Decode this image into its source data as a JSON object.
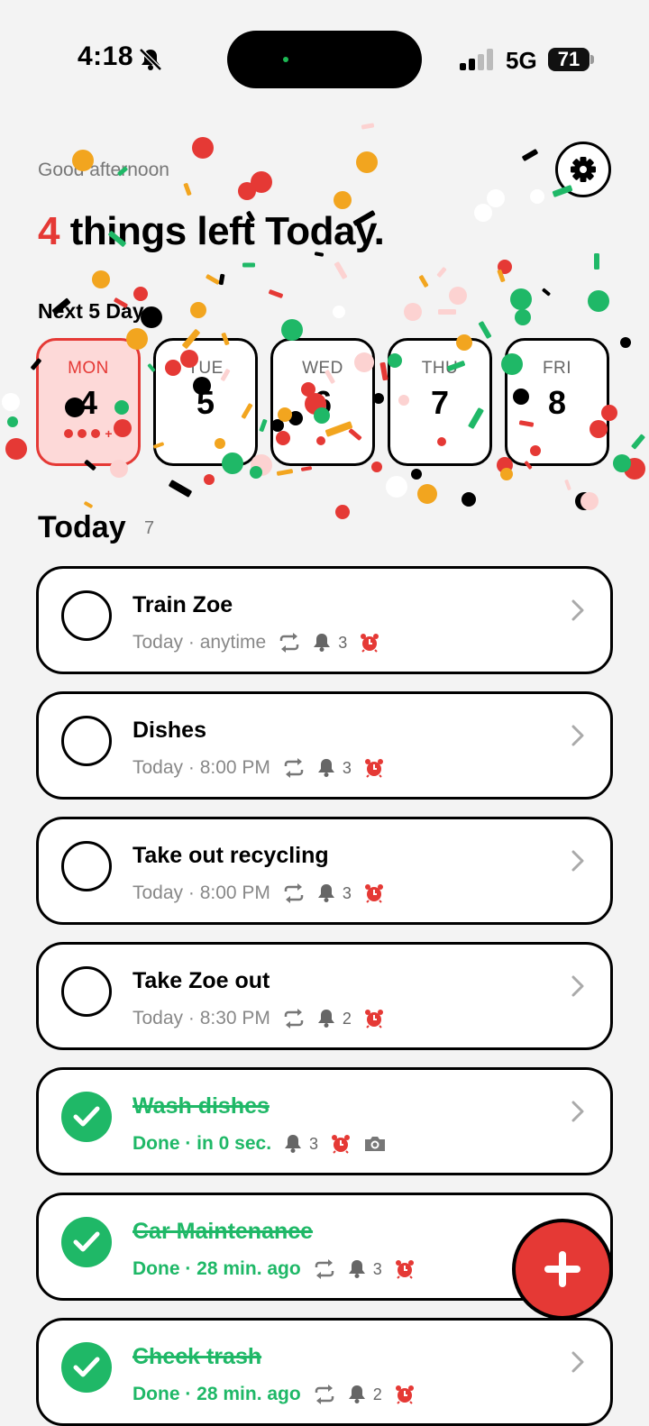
{
  "status_bar": {
    "time": "4:18",
    "network": "5G",
    "battery": "71"
  },
  "header": {
    "greeting": "Good afternoon",
    "count": "4",
    "headline_rest": " things left Today.",
    "next_days_label": "Next 5 Days"
  },
  "days": [
    {
      "name": "MON",
      "number": "4",
      "active": true,
      "dots": 3,
      "more": "+"
    },
    {
      "name": "TUE",
      "number": "5",
      "active": false
    },
    {
      "name": "WED",
      "number": "6",
      "active": false
    },
    {
      "name": "THU",
      "number": "7",
      "active": false
    },
    {
      "name": "FRI",
      "number": "8",
      "active": false
    }
  ],
  "today": {
    "title": "Today",
    "count": "7"
  },
  "tasks": [
    {
      "name": "Train Zoe",
      "meta": "Today · anytime",
      "repeat": true,
      "reminders": "3",
      "alarm": true,
      "photo": false,
      "done": false
    },
    {
      "name": "Dishes",
      "meta": "Today · 8:00 PM",
      "repeat": true,
      "reminders": "3",
      "alarm": true,
      "photo": false,
      "done": false
    },
    {
      "name": "Take out recycling",
      "meta": "Today · 8:00 PM",
      "repeat": true,
      "reminders": "3",
      "alarm": true,
      "photo": false,
      "done": false
    },
    {
      "name": "Take Zoe out",
      "meta": "Today · 8:30 PM",
      "repeat": true,
      "reminders": "2",
      "alarm": true,
      "photo": false,
      "done": false
    },
    {
      "name": "Wash dishes",
      "meta": "Done · in 0 sec.",
      "repeat": false,
      "reminders": "3",
      "alarm": true,
      "photo": true,
      "done": true
    },
    {
      "name": "Car Maintenance",
      "meta": "Done · 28 min. ago",
      "repeat": true,
      "reminders": "3",
      "alarm": true,
      "photo": false,
      "done": true
    },
    {
      "name": "Check trash",
      "meta": "Done · 28 min. ago",
      "repeat": true,
      "reminders": "2",
      "alarm": true,
      "photo": false,
      "done": true
    }
  ],
  "colors": {
    "accent_red": "#e53935",
    "done_green": "#1fb867",
    "confetti_orange": "#f2a51f"
  },
  "icons": [
    "bell-slash-icon",
    "signal-icon",
    "battery-icon",
    "gear-icon",
    "repeat-icon",
    "bell-icon",
    "alarm-clock-icon",
    "camera-icon",
    "chevron-right-icon",
    "plus-icon"
  ]
}
